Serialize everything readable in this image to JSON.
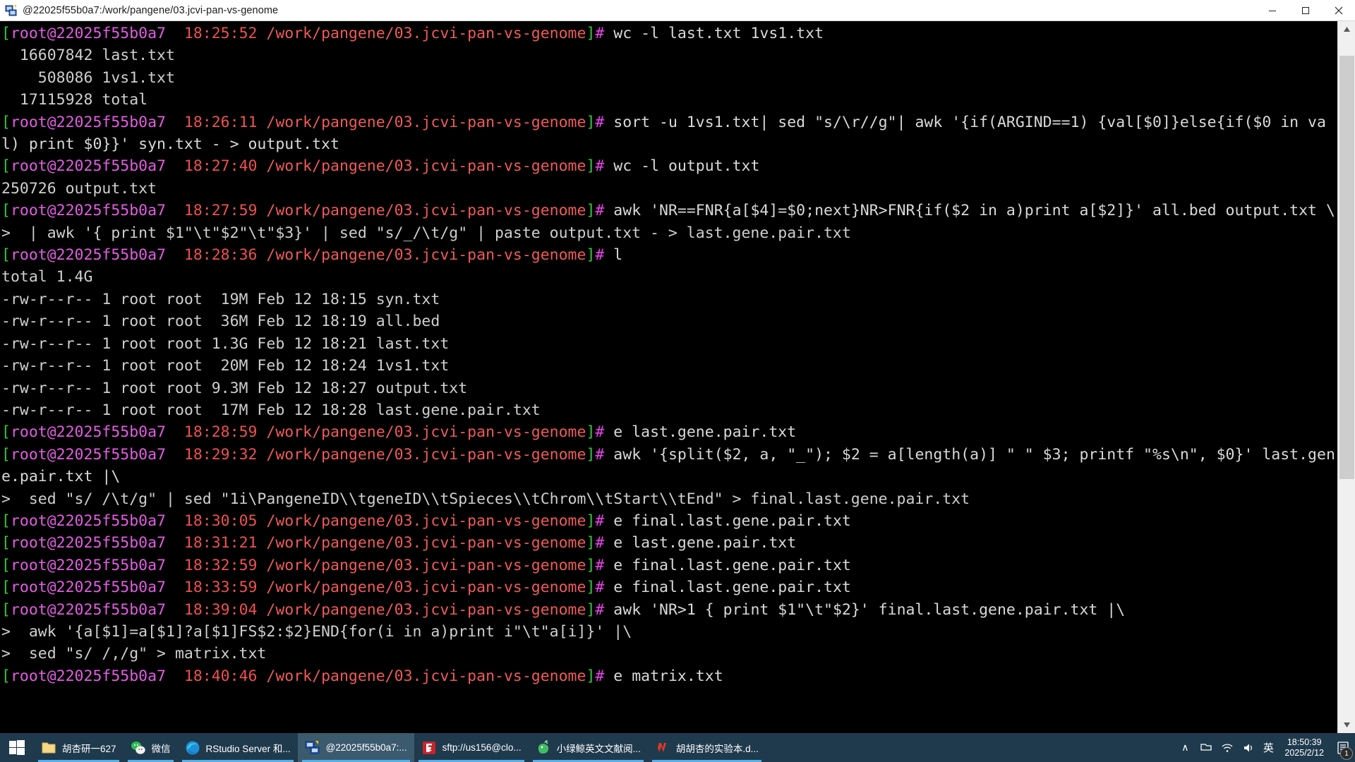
{
  "window": {
    "title": "@22025f55b0a7:/work/pangene/03.jcvi-pan-vs-genome",
    "icon": "terminal-app-icon",
    "minimize_label": "–",
    "maximize_label": "❐",
    "close_label": "✕"
  },
  "terminal": {
    "prompt": {
      "user_host": "root@22025f55b0a7",
      "open_bracket": "[",
      "close_bracket": "]",
      "hash": "#"
    },
    "colors": {
      "background": "#000000",
      "bracket_green": "#35c73b",
      "user_magenta": "#e45ce4",
      "time_red": "#f05050",
      "path_red": "#f05a5a",
      "hash_magenta": "#e840e8",
      "text_grey": "#d8d8d8"
    },
    "path": "/work/pangene/03.jcvi-pan-vs-genome",
    "lines": [
      {
        "type": "prompt",
        "time": "18:25:52",
        "command": " wc -l last.txt 1vs1.txt"
      },
      {
        "type": "output",
        "text": "  16607842 last.txt"
      },
      {
        "type": "output",
        "text": "    508086 1vs1.txt"
      },
      {
        "type": "output",
        "text": "  17115928 total"
      },
      {
        "type": "prompt",
        "time": "18:26:11",
        "command": " sort -u 1vs1.txt| sed \"s/\\r//g\"| awk '{if(ARGIND==1) {val[$0]}else{if($0 in val) print $0}}' syn.txt - > output.txt"
      },
      {
        "type": "prompt",
        "time": "18:27:40",
        "command": " wc -l output.txt"
      },
      {
        "type": "output",
        "text": "250726 output.txt"
      },
      {
        "type": "prompt",
        "time": "18:27:59",
        "command": " awk 'NR==FNR{a[$4]=$0;next}NR>FNR{if($2 in a)print a[$2]}' all.bed output.txt \\"
      },
      {
        "type": "cont",
        "text": ">  | awk '{ print $1\"\\t\"$2\"\\t\"$3}' | sed \"s/_/\\t/g\" | paste output.txt - > last.gene.pair.txt"
      },
      {
        "type": "prompt",
        "time": "18:28:36",
        "command": " l"
      },
      {
        "type": "output",
        "text": "total 1.4G"
      },
      {
        "type": "output",
        "text": "-rw-r--r-- 1 root root  19M Feb 12 18:15 syn.txt"
      },
      {
        "type": "output",
        "text": "-rw-r--r-- 1 root root  36M Feb 12 18:19 all.bed"
      },
      {
        "type": "output",
        "text": "-rw-r--r-- 1 root root 1.3G Feb 12 18:21 last.txt"
      },
      {
        "type": "output",
        "text": "-rw-r--r-- 1 root root  20M Feb 12 18:24 1vs1.txt"
      },
      {
        "type": "output",
        "text": "-rw-r--r-- 1 root root 9.3M Feb 12 18:27 output.txt"
      },
      {
        "type": "output",
        "text": "-rw-r--r-- 1 root root  17M Feb 12 18:28 last.gene.pair.txt"
      },
      {
        "type": "prompt",
        "time": "18:28:59",
        "command": " e last.gene.pair.txt"
      },
      {
        "type": "prompt",
        "time": "18:29:32",
        "command": " awk '{split($2, a, \"_\"); $2 = a[length(a)] \" \" $3; printf \"%s\\n\", $0}' last.gene.pair.txt |\\"
      },
      {
        "type": "cont",
        "text": ">  sed \"s/ /\\t/g\" | sed \"1i\\PangeneID\\\\tgeneID\\\\tSpieces\\\\tChrom\\\\tStart\\\\tEnd\" > final.last.gene.pair.txt"
      },
      {
        "type": "prompt",
        "time": "18:30:05",
        "command": " e final.last.gene.pair.txt"
      },
      {
        "type": "prompt",
        "time": "18:31:21",
        "command": " e last.gene.pair.txt"
      },
      {
        "type": "prompt",
        "time": "18:32:59",
        "command": " e final.last.gene.pair.txt"
      },
      {
        "type": "prompt",
        "time": "18:33:59",
        "command": " e final.last.gene.pair.txt"
      },
      {
        "type": "prompt",
        "time": "18:39:04",
        "command": " awk 'NR>1 { print $1\"\\t\"$2}' final.last.gene.pair.txt |\\"
      },
      {
        "type": "cont",
        "text": ">  awk '{a[$1]=a[$1]?a[$1]FS$2:$2}END{for(i in a)print i\"\\t\"a[i]}' |\\"
      },
      {
        "type": "cont",
        "text": ">  sed \"s/ /,/g\" > matrix.txt"
      },
      {
        "type": "prompt",
        "time": "18:40:46",
        "command": " e matrix.txt"
      }
    ]
  },
  "scrollbar": {
    "up_arrow": "▲",
    "down_arrow": "▼"
  },
  "taskbar": {
    "start_label": "start-button",
    "items": [
      {
        "label": "胡杏研一627",
        "icon": "folder-icon",
        "active": false,
        "underline": true
      },
      {
        "label": "微信",
        "icon": "wechat-icon",
        "active": false,
        "underline": true
      },
      {
        "label": "RStudio Server 和...",
        "icon": "edge-browser-icon",
        "active": false,
        "underline": true
      },
      {
        "label": "@22025f55b0a7:...",
        "icon": "terminal-app-icon",
        "active": true,
        "underline": true
      },
      {
        "label": "sftp://us156@clo...",
        "icon": "filezilla-icon",
        "active": false,
        "underline": true
      },
      {
        "label": "小绿鲸英文文献阅...",
        "icon": "whale-reader-icon",
        "active": false,
        "underline": true
      },
      {
        "label": "胡胡杏的实验本.d...",
        "icon": "wps-writer-icon",
        "active": false,
        "underline": true
      }
    ],
    "tray": {
      "chevron_up": "∧",
      "icons": [
        "show-hidden-icons",
        "onedrive-icon",
        "network-icon",
        "volume-icon"
      ],
      "ime_label": "英",
      "time": "18:50:39",
      "date": "2025/2/12",
      "notification_count": "1"
    }
  }
}
